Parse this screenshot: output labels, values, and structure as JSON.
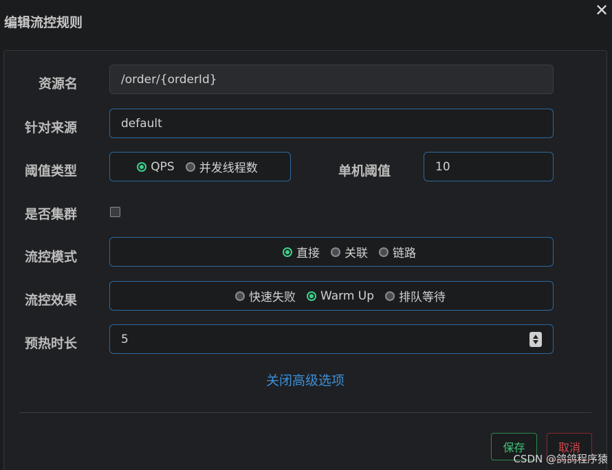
{
  "dialog": {
    "title": "编辑流控规则",
    "close_label": "✕"
  },
  "form": {
    "resource": {
      "label": "资源名",
      "value": "/order/{orderId}"
    },
    "source": {
      "label": "针对来源",
      "value": "default"
    },
    "threshold_type": {
      "label": "阈值类型",
      "options": [
        "QPS",
        "并发线程数"
      ],
      "selected": "QPS"
    },
    "single_threshold": {
      "label": "单机阈值",
      "value": "10"
    },
    "cluster": {
      "label": "是否集群",
      "checked": false
    },
    "mode": {
      "label": "流控模式",
      "options": [
        "直接",
        "关联",
        "链路"
      ],
      "selected": "直接"
    },
    "effect": {
      "label": "流控效果",
      "options": [
        "快速失败",
        "Warm Up",
        "排队等待"
      ],
      "selected": "Warm Up"
    },
    "warmup": {
      "label": "预热时长",
      "value": "5"
    },
    "advanced_link": "关闭高级选项"
  },
  "footer": {
    "save_label": "保存",
    "cancel_label": "取消"
  },
  "watermark": "CSDN @鸽鸽程序猿",
  "colors": {
    "accent_green": "#3ed28a",
    "link_blue": "#3d8fd8",
    "input_border": "#2e6aa0",
    "danger": "#d0474c"
  }
}
